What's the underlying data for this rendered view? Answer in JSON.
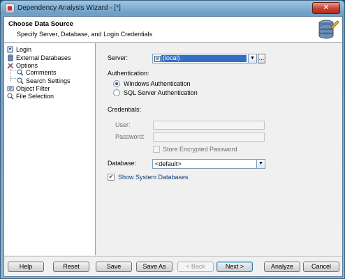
{
  "window": {
    "title": "Dependency Analysis Wizard - [*]",
    "close_label": "✕"
  },
  "header": {
    "title": "Choose Data Source",
    "subtitle": "Specify Server, Database, and Login Credentials"
  },
  "tree": {
    "items": [
      {
        "label": "Login",
        "icon": "login-icon"
      },
      {
        "label": "External Databases",
        "icon": "database-icon"
      },
      {
        "label": "Options",
        "icon": "options-icon"
      },
      {
        "label": "Comments",
        "icon": "comments-icon"
      },
      {
        "label": "Search Settings",
        "icon": "search-settings-icon"
      },
      {
        "label": "Object Filter",
        "icon": "object-filter-icon"
      },
      {
        "label": "File Selection",
        "icon": "file-selection-icon"
      }
    ]
  },
  "form": {
    "server_label": "Server:",
    "server_value": "(local)",
    "server_browse_label": "...",
    "auth_label": "Authentication:",
    "auth_windows": "Windows Authentication",
    "auth_sql": "SQL Server Authentication",
    "credentials_label": "Credentials:",
    "user_label": "User:",
    "password_label": "Password:",
    "store_encrypted_label": "Store Encrypted Password",
    "database_label": "Database:",
    "database_value": "<default>",
    "show_system_label": "Show System Databases",
    "show_system_checked": "✔"
  },
  "buttons": {
    "help": "Help",
    "reset": "Reset",
    "save": "Save",
    "save_as": "Save As",
    "back": "< Back",
    "next": "Next >",
    "analyze": "Analyze",
    "cancel": "Cancel"
  },
  "colors": {
    "selection": "#3170c6",
    "close_button": "#c8412e"
  }
}
